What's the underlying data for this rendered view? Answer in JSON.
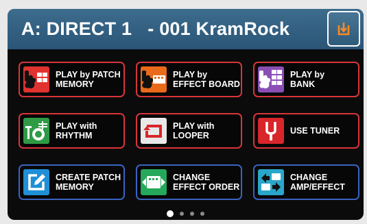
{
  "header": {
    "title": "A: DIRECT 1   - 001 KramRock",
    "save_icon": "save-arrow-icon"
  },
  "tiles": [
    {
      "label": "PLAY by PATCH\nMEMORY",
      "icon": "guitar-patch-icon",
      "color": "#e0322f",
      "border": "#d9353a"
    },
    {
      "label": "PLAY by\nEFFECT BOARD",
      "icon": "guitar-effect-board-icon",
      "color": "#ea6a1c",
      "border": "#d9353a"
    },
    {
      "label": "PLAY by\nBANK",
      "icon": "guitar-bank-icon",
      "color": "#8a4fb5",
      "border": "#d9353a"
    },
    {
      "label": "PLAY with\nRHYTHM",
      "icon": "drum-icon",
      "color": "#2f9a45",
      "border": "#d9353a"
    },
    {
      "label": "PLAY with\nLOOPER",
      "icon": "looper-icon",
      "color": "#e8e8e8",
      "border": "#d9353a"
    },
    {
      "label": "USE TUNER",
      "icon": "tuner-fork-icon",
      "color": "#d8262b",
      "border": "#d9353a"
    },
    {
      "label": "CREATE PATCH\nMEMORY",
      "icon": "edit-icon",
      "color": "#1f8fd6",
      "border": "#3a63c2"
    },
    {
      "label": "CHANGE\nEFFECT ORDER",
      "icon": "effect-order-icon",
      "color": "#25a85a",
      "border": "#3a63c2"
    },
    {
      "label": "CHANGE\nAMP/EFFECT",
      "icon": "amp-effect-icon",
      "color": "#29a6c9",
      "border": "#3a63c2"
    }
  ],
  "pagination": {
    "pages": 4,
    "current": 1
  }
}
